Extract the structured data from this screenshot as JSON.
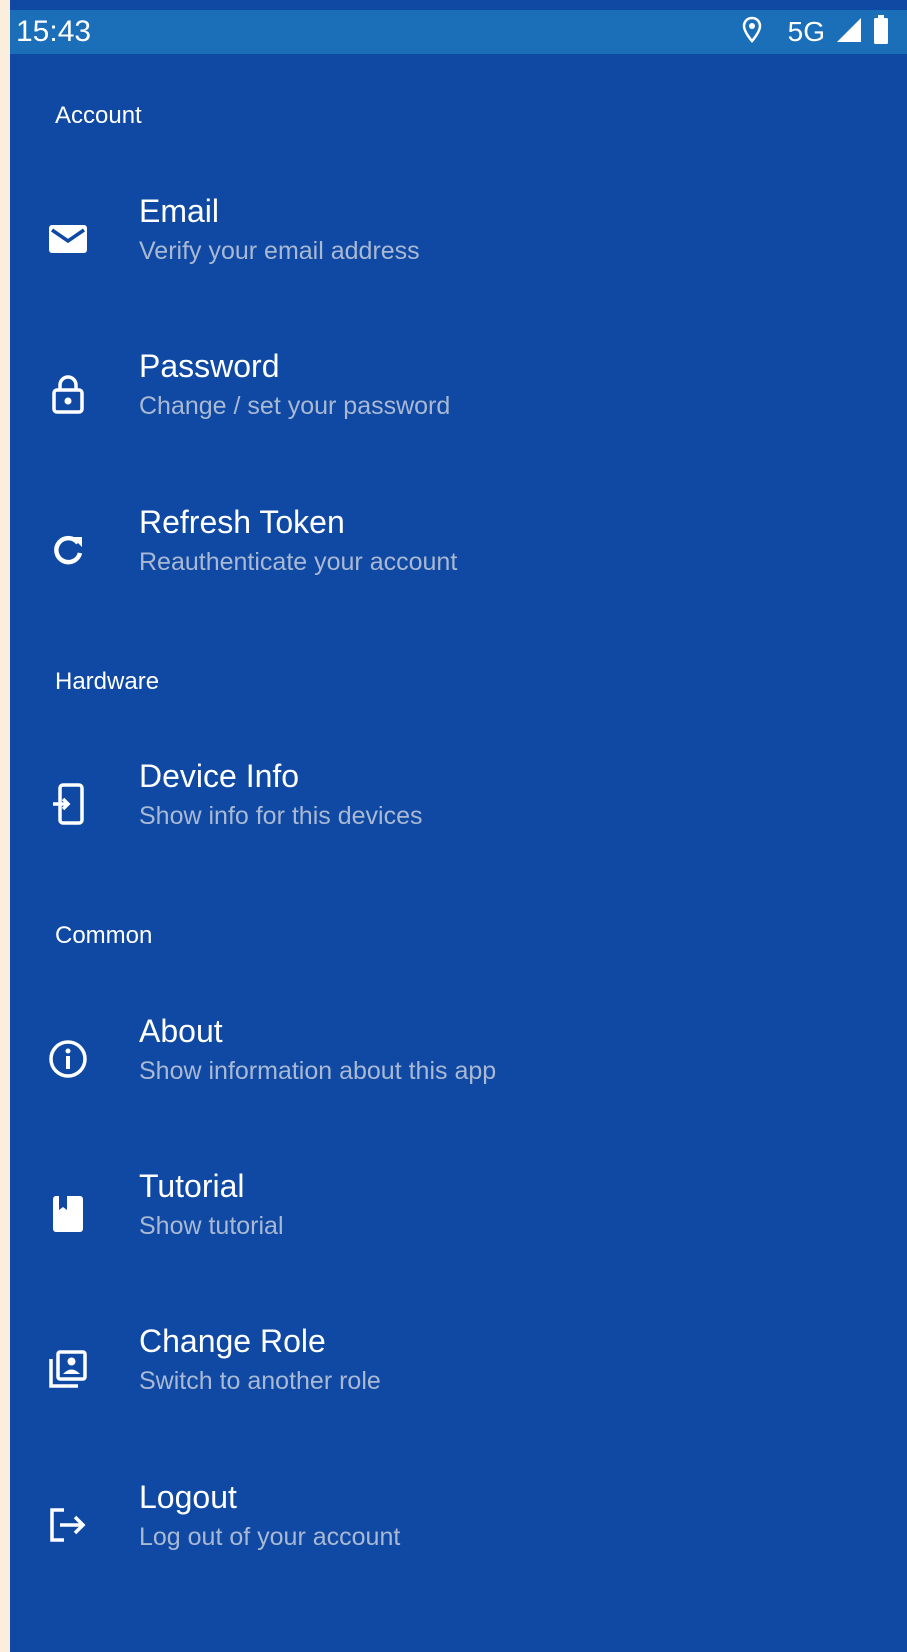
{
  "status_bar": {
    "time": "15:43",
    "network": "5G",
    "icons": [
      "location-icon",
      "signal-icon",
      "battery-icon"
    ]
  },
  "colors": {
    "background": "#0f49a3",
    "status_bar": "#1a6fb8",
    "title_text": "#ffffff",
    "subtitle_text": "#a9b9d3"
  },
  "sections": {
    "account": "Account",
    "hardware": "Hardware",
    "common": "Common"
  },
  "items": {
    "email": {
      "title": "Email",
      "subtitle": "Verify your email address",
      "icon": "email-icon"
    },
    "password": {
      "title": "Password",
      "subtitle": "Change / set your password",
      "icon": "lock-icon"
    },
    "refresh_token": {
      "title": "Refresh Token",
      "subtitle": "Reauthenticate your account",
      "icon": "refresh-icon"
    },
    "device_info": {
      "title": "Device Info",
      "subtitle": "Show info for this devices",
      "icon": "device-info-icon"
    },
    "about": {
      "title": "About",
      "subtitle": "Show information about this app",
      "icon": "info-icon"
    },
    "tutorial": {
      "title": "Tutorial",
      "subtitle": "Show tutorial",
      "icon": "book-icon"
    },
    "change_role": {
      "title": "Change Role",
      "subtitle": "Switch to another role",
      "icon": "switch-account-icon"
    },
    "logout": {
      "title": "Logout",
      "subtitle": "Log out of your account",
      "icon": "logout-icon"
    }
  }
}
